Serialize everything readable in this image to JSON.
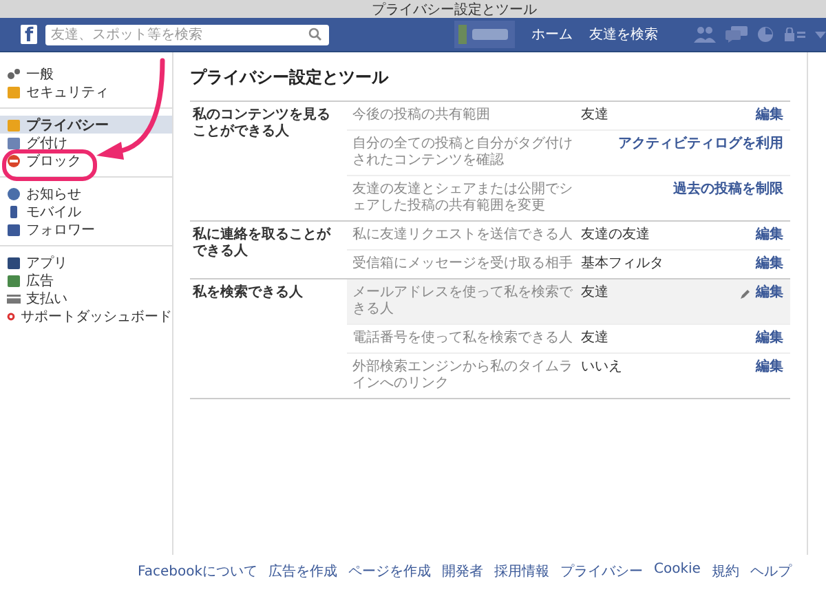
{
  "window": {
    "title": "プライバシー設定とツール"
  },
  "navbar": {
    "logo": "f",
    "search": {
      "placeholder": "友達、スポット等を検索"
    },
    "links": [
      "ホーム",
      "友達を検索"
    ]
  },
  "sidebar": {
    "groups": [
      [
        {
          "label": "一般",
          "selected": false
        },
        {
          "label": "セキュリティ",
          "selected": false
        }
      ],
      [
        {
          "label": "プライバシー",
          "selected": true
        },
        {
          "label": "グ付け",
          "selected": false
        },
        {
          "label": "ブロック",
          "selected": false
        }
      ],
      [
        {
          "label": "お知らせ",
          "selected": false
        },
        {
          "label": "モバイル",
          "selected": false
        },
        {
          "label": "フォロワー",
          "selected": false
        }
      ],
      [
        {
          "label": "アプリ",
          "selected": false
        },
        {
          "label": "広告",
          "selected": false
        },
        {
          "label": "支払い",
          "selected": false
        },
        {
          "label": "サポートダッシュボード",
          "selected": false
        }
      ]
    ]
  },
  "main": {
    "title": "プライバシー設定とツール",
    "sections": [
      {
        "label": "私のコンテンツを見ることができる人",
        "rows": [
          {
            "setting": "今後の投稿の共有範囲",
            "value": "友達",
            "action": "編集",
            "highlighted": false
          },
          {
            "setting": "自分の全ての投稿と自分がタグ付けされたコンテンツを確認",
            "action": "アクティビティログを利用",
            "highlighted": false
          },
          {
            "setting": "友達の友達とシェアまたは公開でシェアした投稿の共有範囲を変更",
            "action": "過去の投稿を制限",
            "highlighted": false
          }
        ]
      },
      {
        "label": "私に連絡を取ることができる人",
        "rows": [
          {
            "setting": "私に友達リクエストを送信できる人",
            "value": "友達の友達",
            "action": "編集",
            "highlighted": false
          },
          {
            "setting": "受信箱にメッセージを受け取る相手",
            "value": "基本フィルタ",
            "action": "編集",
            "highlighted": false
          }
        ]
      },
      {
        "label": "私を検索できる人",
        "rows": [
          {
            "setting": "メールアドレスを使って私を検索できる人",
            "value": "友達",
            "action": "編集",
            "highlighted": true
          },
          {
            "setting": "電話番号を使って私を検索できる人",
            "value": "友達",
            "action": "編集",
            "highlighted": false
          },
          {
            "setting": "外部検索エンジンから私のタイムラインへのリンク",
            "value": "いいえ",
            "action": "編集",
            "highlighted": false
          }
        ]
      }
    ]
  },
  "footer": {
    "links": [
      "Facebookについて",
      "広告を作成",
      "ページを作成",
      "開発者",
      "採用情報",
      "プライバシー",
      "Cookie",
      "規約",
      "ヘルプ"
    ]
  }
}
